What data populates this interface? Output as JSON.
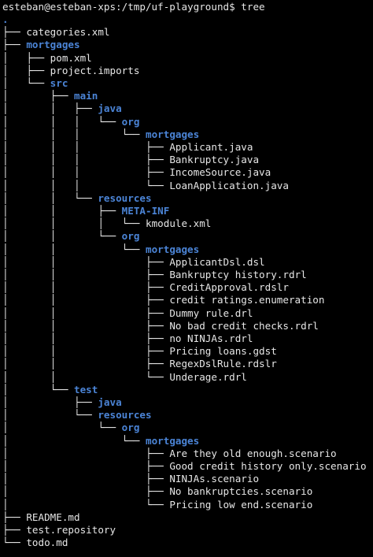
{
  "colors": {
    "background": "#000000",
    "text": "#e6e6e6",
    "directory": "#4b84d6"
  },
  "prompt": "esteban@esteban-xps:/tmp/uf-playground$ tree",
  "entries": [
    {
      "prefix": "",
      "name": ".",
      "kind": "dir"
    },
    {
      "prefix": "├── ",
      "name": "categories.xml",
      "kind": "file"
    },
    {
      "prefix": "├── ",
      "name": "mortgages",
      "kind": "dir"
    },
    {
      "prefix": "│   ├── ",
      "name": "pom.xml",
      "kind": "file"
    },
    {
      "prefix": "│   ├── ",
      "name": "project.imports",
      "kind": "file"
    },
    {
      "prefix": "│   └── ",
      "name": "src",
      "kind": "dir"
    },
    {
      "prefix": "│       ├── ",
      "name": "main",
      "kind": "dir"
    },
    {
      "prefix": "│       │   ├── ",
      "name": "java",
      "kind": "dir"
    },
    {
      "prefix": "│       │   │   └── ",
      "name": "org",
      "kind": "dir"
    },
    {
      "prefix": "│       │   │       └── ",
      "name": "mortgages",
      "kind": "dir"
    },
    {
      "prefix": "│       │   │           ├── ",
      "name": "Applicant.java",
      "kind": "file"
    },
    {
      "prefix": "│       │   │           ├── ",
      "name": "Bankruptcy.java",
      "kind": "file"
    },
    {
      "prefix": "│       │   │           ├── ",
      "name": "IncomeSource.java",
      "kind": "file"
    },
    {
      "prefix": "│       │   │           └── ",
      "name": "LoanApplication.java",
      "kind": "file"
    },
    {
      "prefix": "│       │   └── ",
      "name": "resources",
      "kind": "dir"
    },
    {
      "prefix": "│       │       ├── ",
      "name": "META-INF",
      "kind": "dir"
    },
    {
      "prefix": "│       │       │   └── ",
      "name": "kmodule.xml",
      "kind": "file"
    },
    {
      "prefix": "│       │       └── ",
      "name": "org",
      "kind": "dir"
    },
    {
      "prefix": "│       │           └── ",
      "name": "mortgages",
      "kind": "dir"
    },
    {
      "prefix": "│       │               ├── ",
      "name": "ApplicantDsl.dsl",
      "kind": "file"
    },
    {
      "prefix": "│       │               ├── ",
      "name": "Bankruptcy history.rdrl",
      "kind": "file"
    },
    {
      "prefix": "│       │               ├── ",
      "name": "CreditApproval.rdslr",
      "kind": "file"
    },
    {
      "prefix": "│       │               ├── ",
      "name": "credit ratings.enumeration",
      "kind": "file"
    },
    {
      "prefix": "│       │               ├── ",
      "name": "Dummy rule.drl",
      "kind": "file"
    },
    {
      "prefix": "│       │               ├── ",
      "name": "No bad credit checks.rdrl",
      "kind": "file"
    },
    {
      "prefix": "│       │               ├── ",
      "name": "no NINJAs.rdrl",
      "kind": "file"
    },
    {
      "prefix": "│       │               ├── ",
      "name": "Pricing loans.gdst",
      "kind": "file"
    },
    {
      "prefix": "│       │               ├── ",
      "name": "RegexDslRule.rdslr",
      "kind": "file"
    },
    {
      "prefix": "│       │               └── ",
      "name": "Underage.rdrl",
      "kind": "file"
    },
    {
      "prefix": "│       └── ",
      "name": "test",
      "kind": "dir"
    },
    {
      "prefix": "│           ├── ",
      "name": "java",
      "kind": "dir"
    },
    {
      "prefix": "│           └── ",
      "name": "resources",
      "kind": "dir"
    },
    {
      "prefix": "│               └── ",
      "name": "org",
      "kind": "dir"
    },
    {
      "prefix": "│                   └── ",
      "name": "mortgages",
      "kind": "dir"
    },
    {
      "prefix": "│                       ├── ",
      "name": "Are they old enough.scenario",
      "kind": "file"
    },
    {
      "prefix": "│                       ├── ",
      "name": "Good credit history only.scenario",
      "kind": "file"
    },
    {
      "prefix": "│                       ├── ",
      "name": "NINJAs.scenario",
      "kind": "file"
    },
    {
      "prefix": "│                       ├── ",
      "name": "No bankruptcies.scenario",
      "kind": "file"
    },
    {
      "prefix": "│                       └── ",
      "name": "Pricing low end.scenario",
      "kind": "file"
    },
    {
      "prefix": "├── ",
      "name": "README.md",
      "kind": "file"
    },
    {
      "prefix": "├── ",
      "name": "test.repository",
      "kind": "file"
    },
    {
      "prefix": "└── ",
      "name": "todo.md",
      "kind": "file"
    }
  ]
}
